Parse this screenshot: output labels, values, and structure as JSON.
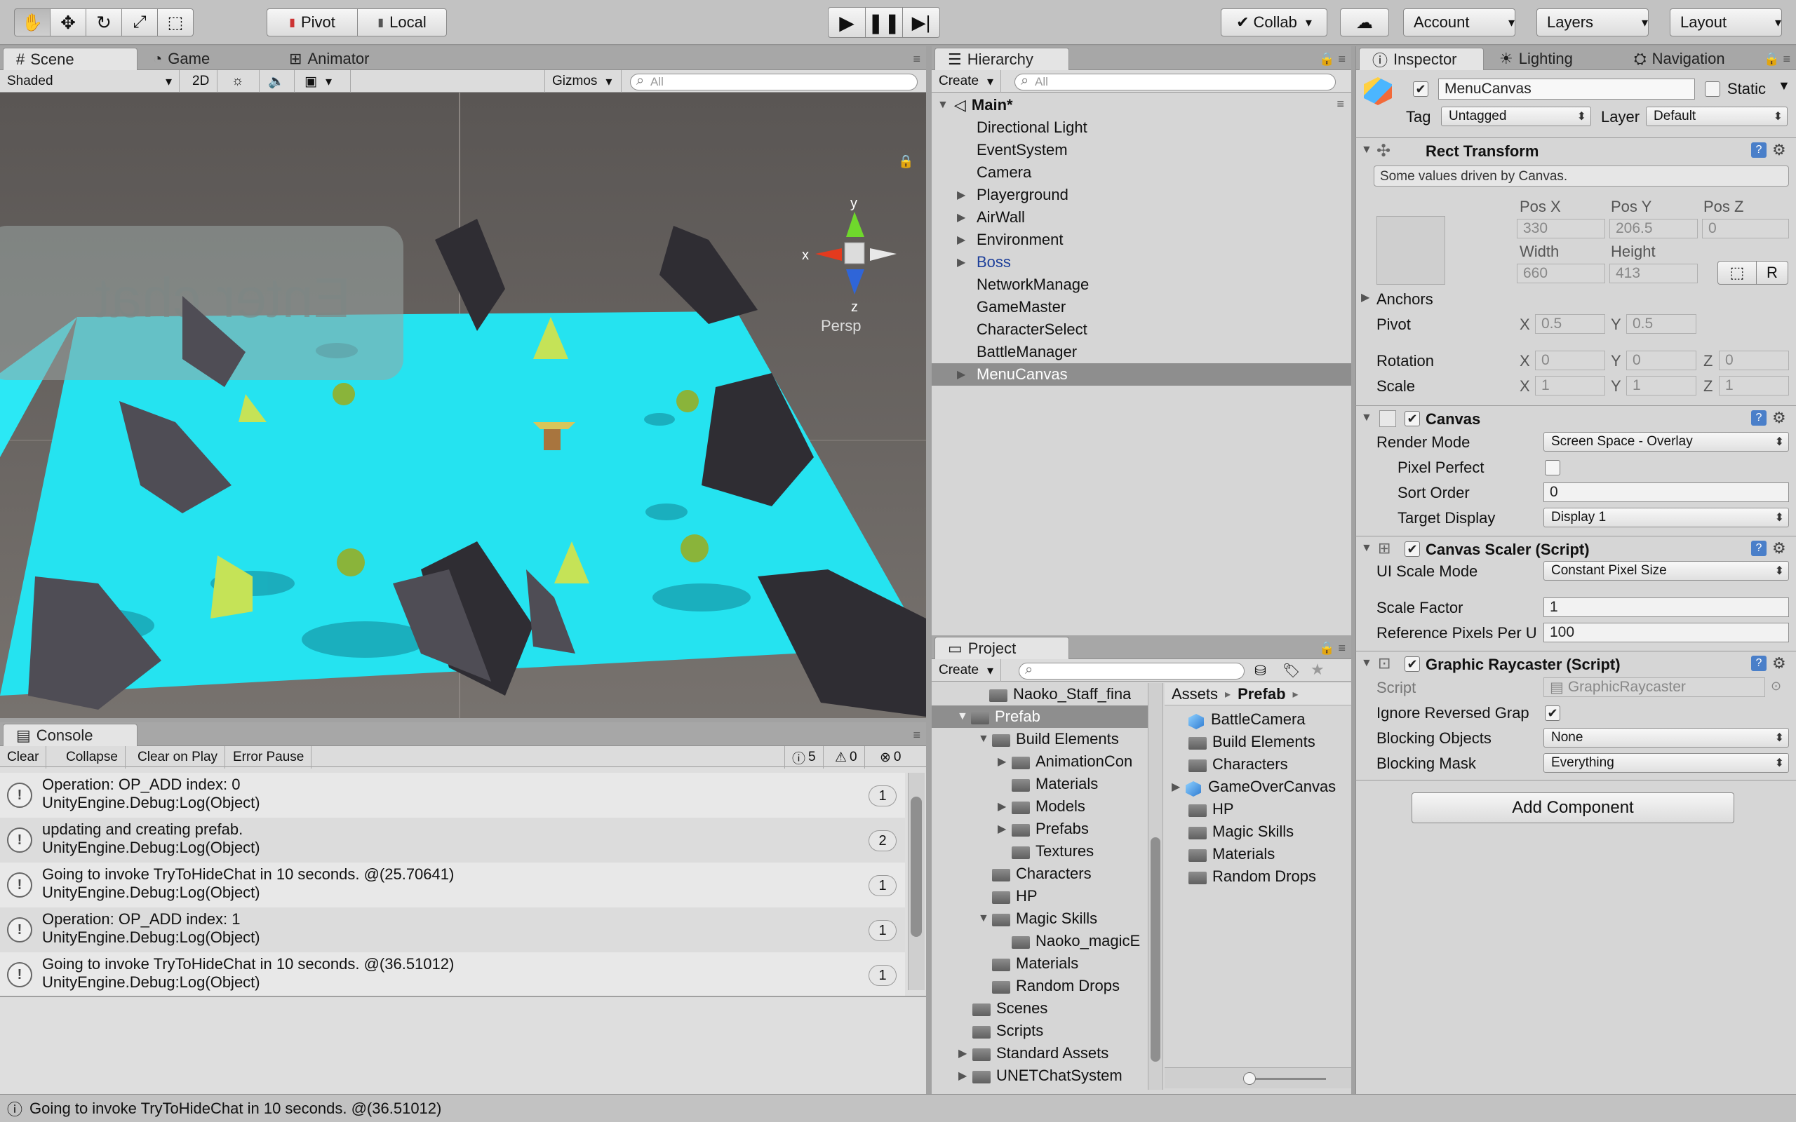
{
  "toolbar": {
    "pivot": "Pivot",
    "local": "Local",
    "collab": "Collab",
    "account": "Account",
    "layers": "Layers",
    "layout": "Layout"
  },
  "scene": {
    "tabs": [
      "Scene",
      "Game",
      "Animator"
    ],
    "shaded": "Shaded",
    "mode_2d": "2D",
    "gizmos": "Gizmos",
    "search_placeholder": "All",
    "gizmo_y": "y",
    "gizmo_x": "x",
    "gizmo_z": "z",
    "persp": "Persp",
    "ui_text": "Enter chat"
  },
  "hierarchy": {
    "tab": "Hierarchy",
    "create": "Create",
    "search_placeholder": "All",
    "scene_name": "Main*",
    "items": [
      {
        "label": "Directional Light",
        "expandable": false
      },
      {
        "label": "EventSystem",
        "expandable": false
      },
      {
        "label": "Camera",
        "expandable": false
      },
      {
        "label": "Playerground",
        "expandable": true
      },
      {
        "label": "AirWall",
        "expandable": true
      },
      {
        "label": "Environment",
        "expandable": true
      },
      {
        "label": "Boss",
        "expandable": true
      },
      {
        "label": "NetworkManage",
        "expandable": false
      },
      {
        "label": "GameMaster",
        "expandable": false
      },
      {
        "label": "CharacterSelect",
        "expandable": false
      },
      {
        "label": "BattleManager",
        "expandable": false
      },
      {
        "label": "MenuCanvas",
        "expandable": true
      }
    ],
    "selected": "MenuCanvas"
  },
  "project": {
    "tab": "Project",
    "create": "Create",
    "tree": [
      "Naoko_Staff_fina",
      "Prefab",
      "Build Elements",
      "AnimationCon",
      "Materials",
      "Models",
      "Prefabs",
      "Textures",
      "Characters",
      "HP",
      "Magic Skills",
      "Naoko_magicE",
      "Materials",
      "Random Drops",
      "Scenes",
      "Scripts",
      "Standard Assets",
      "UNETChatSystem"
    ],
    "breadcrumb": [
      "Assets",
      "Prefab"
    ],
    "assets": [
      {
        "label": "BattleCamera",
        "type": "prefab"
      },
      {
        "label": "Build Elements",
        "type": "folder"
      },
      {
        "label": "Characters",
        "type": "folder"
      },
      {
        "label": "GameOverCanvas",
        "type": "prefab"
      },
      {
        "label": "HP",
        "type": "folder"
      },
      {
        "label": "Magic Skills",
        "type": "folder"
      },
      {
        "label": "Materials",
        "type": "folder"
      },
      {
        "label": "Random Drops",
        "type": "folder"
      }
    ]
  },
  "console": {
    "tab": "Console",
    "buttons": [
      "Clear",
      "Collapse",
      "Clear on Play",
      "Error Pause"
    ],
    "counts": {
      "logs": "5",
      "warnings": "0",
      "errors": "0"
    },
    "entries": [
      {
        "l1": "Operation: OP_ADD index: 0",
        "l2": "UnityEngine.Debug:Log(Object)",
        "count": "1"
      },
      {
        "l1": "updating and creating prefab.",
        "l2": "UnityEngine.Debug:Log(Object)",
        "count": "2"
      },
      {
        "l1": "Going to invoke TryToHideChat in 10 seconds. @(25.70641)",
        "l2": "UnityEngine.Debug:Log(Object)",
        "count": "1"
      },
      {
        "l1": "Operation: OP_ADD index: 1",
        "l2": "UnityEngine.Debug:Log(Object)",
        "count": "1"
      },
      {
        "l1": "Going to invoke TryToHideChat in 10 seconds. @(36.51012)",
        "l2": "UnityEngine.Debug:Log(Object)",
        "count": "1"
      }
    ]
  },
  "status_bar": "Going to invoke TryToHideChat in 10 seconds. @(36.51012)",
  "inspector": {
    "tabs": [
      "Inspector",
      "Lighting",
      "Navigation"
    ],
    "object_name": "MenuCanvas",
    "static": "Static",
    "tag_label": "Tag",
    "tag_value": "Untagged",
    "layer_label": "Layer",
    "layer_value": "Default",
    "rect_transform": {
      "title": "Rect Transform",
      "note": "Some values driven by Canvas.",
      "posx_label": "Pos X",
      "posy_label": "Pos Y",
      "posz_label": "Pos Z",
      "posx": "330",
      "posy": "206.5",
      "posz": "0",
      "width_label": "Width",
      "height_label": "Height",
      "width": "660",
      "height": "413",
      "r_button": "R",
      "anchors": "Anchors",
      "pivot": "Pivot",
      "pivot_x": "0.5",
      "pivot_y": "0.5",
      "rotation": "Rotation",
      "rot_x": "0",
      "rot_y": "0",
      "rot_z": "0",
      "scale": "Scale",
      "scale_x": "1",
      "scale_y": "1",
      "scale_z": "1",
      "x": "X",
      "y": "Y",
      "z": "Z"
    },
    "canvas": {
      "title": "Canvas",
      "render_mode_label": "Render Mode",
      "render_mode": "Screen Space - Overlay",
      "pixel_perfect": "Pixel Perfect",
      "sort_order_label": "Sort Order",
      "sort_order": "0",
      "target_display_label": "Target Display",
      "target_display": "Display 1"
    },
    "canvas_scaler": {
      "title": "Canvas Scaler (Script)",
      "ui_scale_mode_label": "UI Scale Mode",
      "ui_scale_mode": "Constant Pixel Size",
      "scale_factor_label": "Scale Factor",
      "scale_factor": "1",
      "ref_ppu_label": "Reference Pixels Per U",
      "ref_ppu": "100"
    },
    "graphic_raycaster": {
      "title": "Graphic Raycaster (Script)",
      "script_label": "Script",
      "script": "GraphicRaycaster",
      "ignore_reversed": "Ignore Reversed Grap",
      "blocking_objects_label": "Blocking Objects",
      "blocking_objects": "None",
      "blocking_mask_label": "Blocking Mask",
      "blocking_mask": "Everything"
    },
    "add_component": "Add Component"
  }
}
